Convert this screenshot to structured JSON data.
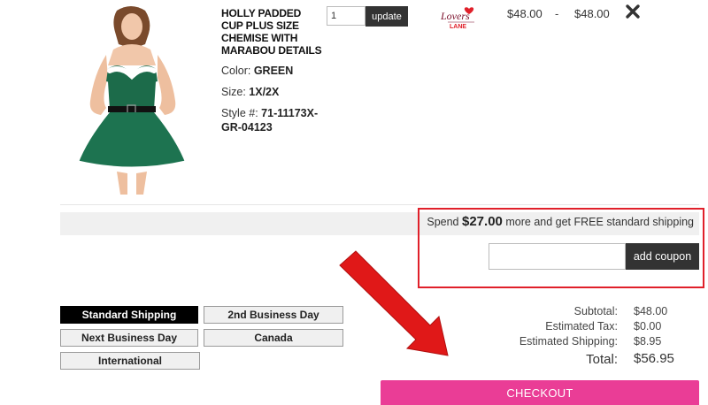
{
  "product": {
    "name": "HOLLY PADDED CUP PLUS SIZE CHEMISE WITH MARABOU DETAILS",
    "color_label": "Color:",
    "color_value": "GREEN",
    "size_label": "Size:",
    "size_value": "1X/2X",
    "style_label": "Style #:",
    "style_value": "71-11173X-GR-04123",
    "quantity": "1",
    "update_label": "update",
    "brand_logo": "lovers-lane-logo",
    "unit_price": "$48.00",
    "separator": "-",
    "line_total": "$48.00",
    "remove_icon": "close-x-icon"
  },
  "shipping_promo": {
    "prefix": "Spend",
    "amount": "$27.00",
    "suffix": "more and get FREE standard shipping"
  },
  "coupon": {
    "placeholder": "",
    "button_label": "add coupon"
  },
  "shipping_options": [
    {
      "label": "Standard Shipping",
      "active": true
    },
    {
      "label": "2nd Business Day",
      "active": false
    },
    {
      "label": "Next Business Day",
      "active": false
    },
    {
      "label": "Canada",
      "active": false
    },
    {
      "label": "International",
      "active": false
    }
  ],
  "summary": {
    "subtotal_label": "Subtotal:",
    "subtotal_value": "$48.00",
    "tax_label": "Estimated Tax:",
    "tax_value": "$0.00",
    "shipping_label": "Estimated Shipping:",
    "shipping_value": "$8.95",
    "total_label": "Total:",
    "total_value": "$56.95"
  },
  "checkout_label": "CHECKOUT",
  "colors": {
    "checkout": "#ea3d96",
    "highlight": "#e0202a",
    "dark_button": "#333333",
    "product_green": "#1c6b4a"
  }
}
